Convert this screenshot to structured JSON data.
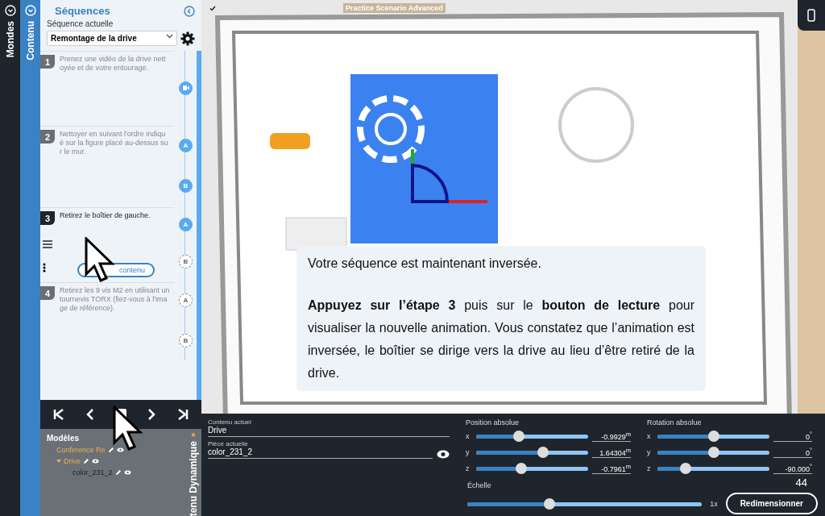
{
  "side_tabs": [
    {
      "label": "Mondes",
      "selected": false
    },
    {
      "label": "Contenu",
      "selected": true
    }
  ],
  "panel": {
    "title": "Séquences",
    "current_label": "Séquence actuelle",
    "current_value": "Remontage de la drive"
  },
  "steps": [
    {
      "number": "1",
      "text": "Prenez une vidéo de la drive nett oyée et de votre entourage.",
      "selected": false,
      "markers": [
        {
          "kind": "video"
        }
      ]
    },
    {
      "number": "2",
      "text": "Nettoyer en suivant l'ordre indiqu é sur la figure placé au-dessus su r le mur.",
      "selected": false,
      "markers": [
        {
          "kind": "point",
          "label": "A"
        },
        {
          "kind": "point",
          "label": "B"
        }
      ]
    },
    {
      "number": "3",
      "text": "Retirez le boîtier de gauche.",
      "selected": true,
      "markers": [
        {
          "kind": "point",
          "label": "A"
        },
        {
          "kind": "outline",
          "label": "B"
        }
      ],
      "button": "contenu"
    },
    {
      "number": "4",
      "text": "Retirez les 9 vis M2 en utilisant un tournevis TORX (fiez-vous à l'ima ge de référence).",
      "selected": false,
      "markers": [
        {
          "kind": "outline",
          "label": "A"
        },
        {
          "kind": "outline",
          "label": "B"
        }
      ]
    }
  ],
  "models": {
    "title": "Modèles",
    "side_label": "tenu Dynamique",
    "tree": [
      {
        "label": "Conference Re",
        "expanded": false
      },
      {
        "label": "Drive",
        "expanded": true,
        "children": [
          {
            "label": "color_231_2",
            "expanded": false
          }
        ]
      }
    ]
  },
  "viewport": {
    "title": "Practice Scenario Advanced"
  },
  "message": {
    "lines": [
      "Votre séquence est maintenant inversée.",
      "**Appuyez sur l’étape 3** puis sur le **bouton de lecture** pour visualiser la nouvelle animation. Vous constatez que l’animation est inversée, le boîtier se dirige vers la drive au lieu d’être retiré de la drive."
    ]
  },
  "properties": {
    "content_label": "Contenu actuel",
    "content_value": "Drive",
    "part_label": "Pièce actuelle",
    "part_value": "color_231_2",
    "position": {
      "title": "Position absolue",
      "axes": [
        {
          "axis": "x",
          "level": 0.38,
          "value": "-0.9929$^{m}$"
        },
        {
          "axis": "y",
          "level": 0.6,
          "value": "1.64304$^{m}$"
        },
        {
          "axis": "z",
          "level": 0.4,
          "value": "-0.7961$^{m}$"
        }
      ]
    },
    "rotation": {
      "title": "Rotation absolue",
      "axes": [
        {
          "axis": "x",
          "level": 0.5,
          "value": "0$^{°}$"
        },
        {
          "axis": "y",
          "level": 0.5,
          "value": "0$^{°}$"
        },
        {
          "axis": "z",
          "level": 0.25,
          "value": "-90.000$^{°}$"
        }
      ]
    },
    "scale": {
      "title": "Échelle",
      "level": 0.35,
      "value": "1x"
    },
    "resize_button": "Redimensionner",
    "page_number": "44"
  }
}
